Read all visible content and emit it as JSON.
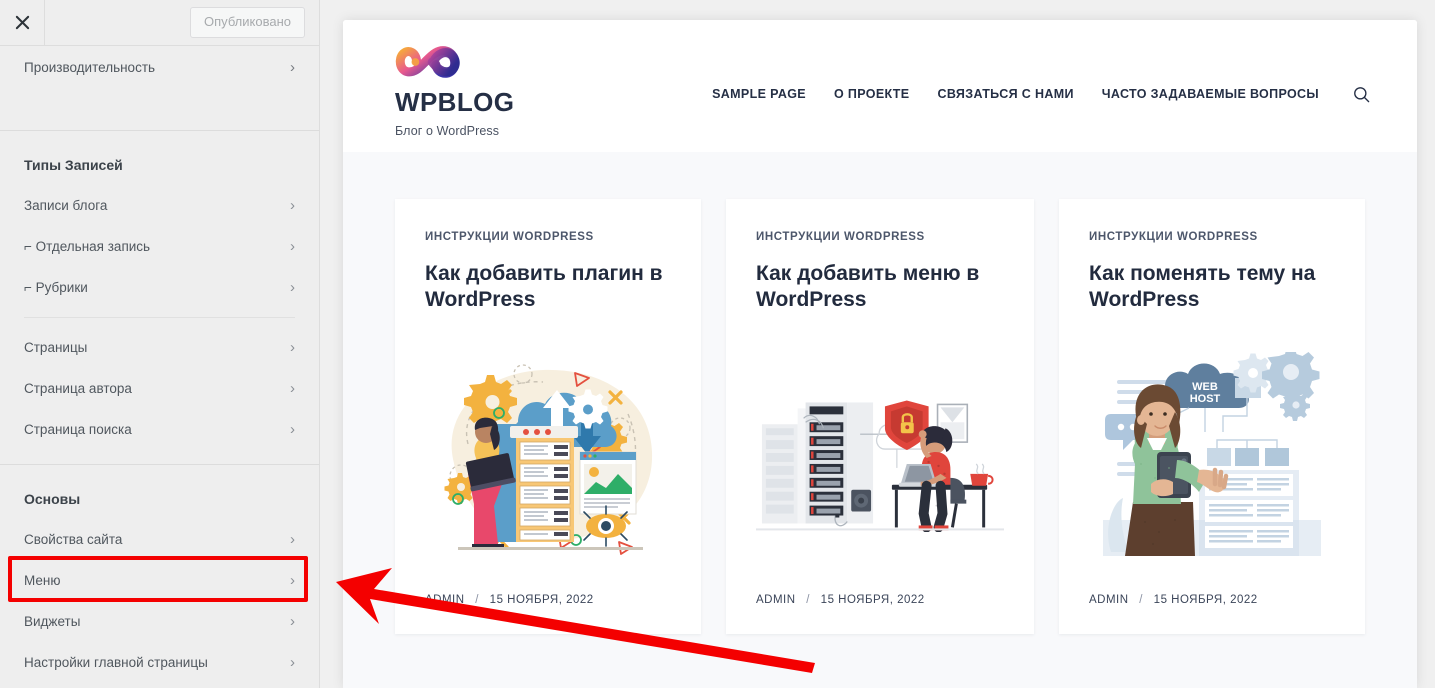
{
  "customizer": {
    "close_icon": "close-icon",
    "publish_label": "Опубликовано",
    "panel_above": {
      "label": "Производительность",
      "chevron": "›"
    },
    "groups": [
      {
        "title": "Типы Записей",
        "items": [
          {
            "label": "Записи блога",
            "chevron": "›",
            "child": false
          },
          {
            "label": "⌐ Отдельная запись",
            "chevron": "›",
            "child": true
          },
          {
            "label": "⌐ Рубрики",
            "chevron": "›",
            "child": true
          },
          {
            "label": "Страницы",
            "chevron": "›",
            "child": false
          },
          {
            "label": "Страница автора",
            "chevron": "›",
            "child": false
          },
          {
            "label": "Страница поиска",
            "chevron": "›",
            "child": false
          }
        ]
      },
      {
        "title": "Основы",
        "items": [
          {
            "label": "Свойства сайта",
            "chevron": "›",
            "child": false
          },
          {
            "label": "Меню",
            "chevron": "›",
            "child": false
          },
          {
            "label": "Виджеты",
            "chevron": "›",
            "child": false
          },
          {
            "label": "Настройки главной страницы",
            "chevron": "›",
            "child": false
          }
        ]
      }
    ],
    "highlighted_item": "Меню",
    "highlight_color": "#f40000"
  },
  "site": {
    "logo_icon": "infinity-logo-icon",
    "title": "WPBLOG",
    "tagline": "Блог о WordPress",
    "nav": [
      {
        "label": "SAMPLE PAGE"
      },
      {
        "label": "О ПРОЕКТЕ"
      },
      {
        "label": "СВЯЗАТЬСЯ С НАМИ"
      },
      {
        "label": "ЧАСТО ЗАДАВАЕМЫЕ ВОПРОСЫ"
      }
    ],
    "search_icon": "search-icon",
    "posts": [
      {
        "category": "ИНСТРУКЦИИ WORDPRESS",
        "title": "Как добавить плагин в WordPress",
        "author": "ADMIN",
        "separator": "/",
        "date": "15 НОЯБРЯ, 2022",
        "thumb_icon": "cloud-server-woman-laptop-illustration"
      },
      {
        "category": "ИНСТРУКЦИИ WORDPRESS",
        "title": "Как добавить меню в WordPress",
        "author": "ADMIN",
        "separator": "/",
        "date": "15 НОЯБРЯ, 2022",
        "thumb_icon": "server-rack-security-desk-illustration"
      },
      {
        "category": "ИНСТРУКЦИИ WORDPRESS",
        "title": "Как поменять тему на WordPress",
        "author": "ADMIN",
        "separator": "/",
        "date": "15 НОЯБРЯ, 2022",
        "thumb_icon": "web-host-woman-tablet-illustration"
      }
    ],
    "webhost_badge_line1": "WEB",
    "webhost_badge_line2": "HOST"
  },
  "annotation": {
    "arrow_icon": "red-arrow-pointing-left",
    "arrow_color": "#f40000"
  },
  "colors": {
    "brand_dark": "#252f45",
    "sidebar_bg": "#eeeeee",
    "preview_bg": "#f8f9fb",
    "accent_red": "#f40000"
  }
}
